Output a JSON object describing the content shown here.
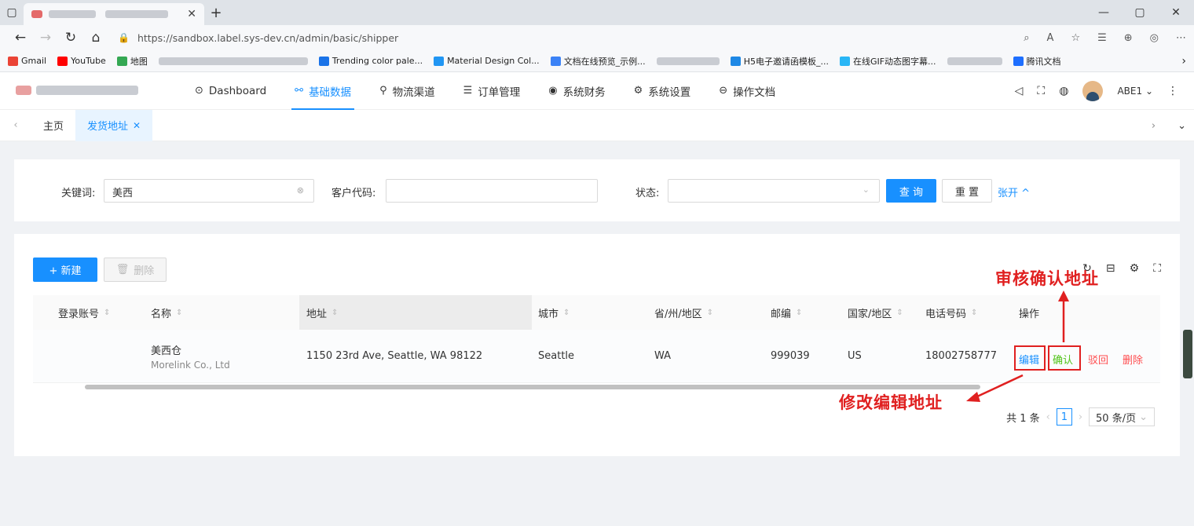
{
  "browser": {
    "url": "https://sandbox.label.sys-dev.cn/admin/basic/shipper",
    "bookmarks": [
      {
        "label": "Gmail",
        "color": "#ea4335"
      },
      {
        "label": "YouTube",
        "color": "#ff0000"
      },
      {
        "label": "地图",
        "color": "#34a853"
      },
      {
        "label": "Trending color pale...",
        "color": "#1a73e8"
      },
      {
        "label": "Material Design Col...",
        "color": "#2196f3"
      },
      {
        "label": "文档在线预览_示例...",
        "color": "#3b82f6"
      },
      {
        "label": "H5电子邀请函模板_...",
        "color": "#1e88e5"
      },
      {
        "label": "在线GIF动态图字幕...",
        "color": "#29b6f6"
      },
      {
        "label": "腾讯文档",
        "color": "#1e6fff"
      }
    ]
  },
  "header": {
    "menu": [
      {
        "label": "Dashboard",
        "icon": "⊙"
      },
      {
        "label": "基础数据",
        "icon": "⚯"
      },
      {
        "label": "物流渠道",
        "icon": "⚲"
      },
      {
        "label": "订单管理",
        "icon": "☰"
      },
      {
        "label": "系统财务",
        "icon": "◉"
      },
      {
        "label": "系统设置",
        "icon": "⚙"
      },
      {
        "label": "操作文档",
        "icon": "⊖"
      }
    ],
    "user": "ABE1"
  },
  "tabs": {
    "home": "主页",
    "current": "发货地址"
  },
  "search": {
    "keyword_label": "关键词:",
    "keyword_value": "美西",
    "customer_label": "客户代码:",
    "customer_value": "",
    "status_label": "状态:",
    "status_value": "",
    "query_btn": "查 询",
    "reset_btn": "重 置",
    "expand_link": "张开 ^"
  },
  "toolbar": {
    "new_btn": "+ 新建",
    "delete_btn": "删除"
  },
  "table": {
    "columns": [
      "登录账号",
      "名称",
      "地址",
      "城市",
      "省/州/地区",
      "邮编",
      "国家/地区",
      "电话号码",
      "操作"
    ],
    "rows": [
      {
        "account": "",
        "name": "美西仓",
        "name_sub": "Morelink Co., Ltd",
        "address": "1150 23rd Ave, Seattle, WA 98122",
        "city": "Seattle",
        "state": "WA",
        "zip": "999039",
        "country": "US",
        "phone": "18002758777",
        "actions": {
          "edit": "编辑",
          "confirm": "确认",
          "reject": "驳回",
          "delete": "删除"
        }
      }
    ]
  },
  "pagination": {
    "total": "共 1 条",
    "current": "1",
    "page_size": "50 条/页"
  },
  "annotations": {
    "confirm_note": "审核确认地址",
    "edit_note": "修改编辑地址"
  }
}
